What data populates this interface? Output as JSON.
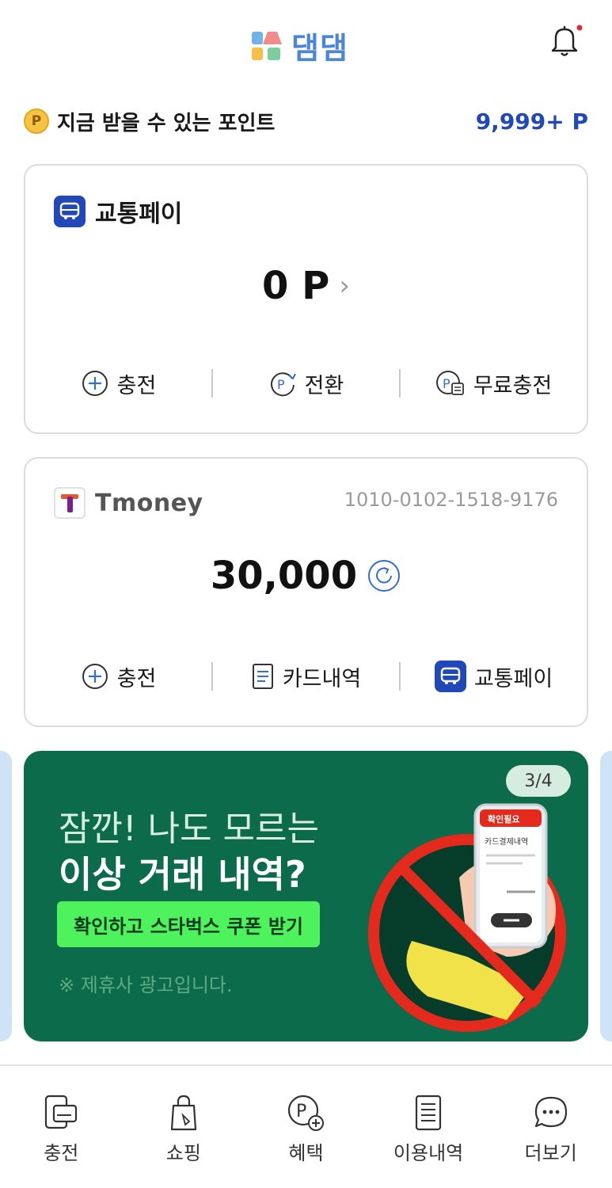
{
  "header": {
    "logo_text": "댐댐",
    "bell_has_badge": true,
    "colors": {
      "logo": "#4a86d9",
      "badge": "#e0282e"
    }
  },
  "points": {
    "icon_letter": "P",
    "label": "지금 받을 수 있는 포인트",
    "value": "9,999+ P"
  },
  "transit_pay_card": {
    "title": "교통페이",
    "amount": "0 P",
    "chevron": "›",
    "actions": [
      {
        "label": "충전",
        "icon": "plus-circle-icon"
      },
      {
        "label": "전환",
        "icon": "point-convert-icon"
      },
      {
        "label": "무료충전",
        "icon": "point-card-icon"
      }
    ]
  },
  "tmoney_card": {
    "brand": "Tmoney",
    "card_number": "1010-0102-1518-9176",
    "balance": "30,000",
    "actions": [
      {
        "label": "충전",
        "icon": "plus-circle-icon"
      },
      {
        "label": "카드내역",
        "icon": "document-icon"
      },
      {
        "label": "교통페이",
        "icon": "bus-icon"
      }
    ]
  },
  "banner": {
    "pager": "3/4",
    "line1": "잠깐! 나도 모르는",
    "line2": "이상 거래 내역?",
    "cta": "확인하고 스타벅스 쿠폰 받기",
    "note": "※ 제휴사 광고입니다.",
    "phone_alert": "확인필요",
    "phone_text": "카드결제내역",
    "colors": {
      "bg": "#0b6b4b",
      "cta": "#4ef25c"
    }
  },
  "bottom_nav": [
    {
      "label": "충전",
      "icon": "phone-card-icon"
    },
    {
      "label": "쇼핑",
      "icon": "shopping-bag-icon"
    },
    {
      "label": "혜택",
      "icon": "point-plus-icon"
    },
    {
      "label": "이용내역",
      "icon": "list-document-icon"
    },
    {
      "label": "더보기",
      "icon": "chat-more-icon"
    }
  ]
}
